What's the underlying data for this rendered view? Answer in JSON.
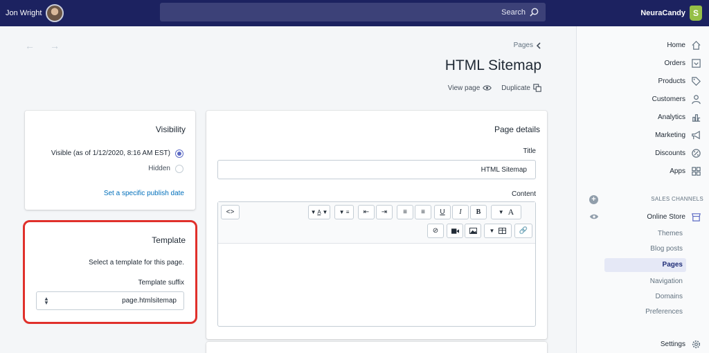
{
  "topbar": {
    "user_name": "Jon Wright",
    "search_placeholder": "Search",
    "store_name": "NeuraCandy",
    "logo_letter": "S"
  },
  "sidebar": {
    "items": [
      {
        "label": "Home",
        "icon": "home-icon"
      },
      {
        "label": "Orders",
        "icon": "orders-icon"
      },
      {
        "label": "Products",
        "icon": "tag-icon"
      },
      {
        "label": "Customers",
        "icon": "person-icon"
      },
      {
        "label": "Analytics",
        "icon": "bar-chart-icon"
      },
      {
        "label": "Marketing",
        "icon": "megaphone-icon"
      },
      {
        "label": "Discounts",
        "icon": "discount-icon"
      },
      {
        "label": "Apps",
        "icon": "apps-icon"
      }
    ],
    "sales_channels_title": "SALES CHANNELS",
    "online_store": "Online Store",
    "sub_items": [
      "Themes",
      "Blog posts",
      "Pages",
      "Navigation",
      "Domains",
      "Preferences"
    ],
    "active_sub_item": "Pages",
    "settings": "Settings"
  },
  "header": {
    "breadcrumb": "Pages",
    "title": "HTML Sitemap",
    "duplicate": "Duplicate",
    "view_page": "View page"
  },
  "page_details": {
    "heading": "Page details",
    "title_label": "Title",
    "title_value": "HTML Sitemap",
    "content_label": "Content",
    "html_button": "<>",
    "toolbar_row1": [
      "A",
      "B",
      "I",
      "U"
    ],
    "toolbar_icons_row1": [
      "align-center-icon",
      "list-bullet-icon",
      "list-numbered-icon",
      "outdent-icon",
      "indent-icon",
      "align-icon",
      "text-color-icon"
    ],
    "toolbar_icons_row2": [
      "link-icon",
      "table-icon",
      "image-icon",
      "video-icon",
      "clear-format-icon"
    ]
  },
  "visibility": {
    "heading": "Visibility",
    "visible_option": "Visible (as of 1/12/2020, 8:16 AM EST)",
    "hidden_option": "Hidden",
    "selected": "visible",
    "publish_link": "Set a specific publish date"
  },
  "template": {
    "heading": "Template",
    "description": "Select a template for this page.",
    "suffix_label": "Template suffix",
    "suffix_value": "page.htmlsitemap",
    "highlight_color": "#e0302b"
  },
  "colors": {
    "topbar": "#1c2260",
    "accent": "#5c6ac4",
    "link": "#006fbb"
  }
}
